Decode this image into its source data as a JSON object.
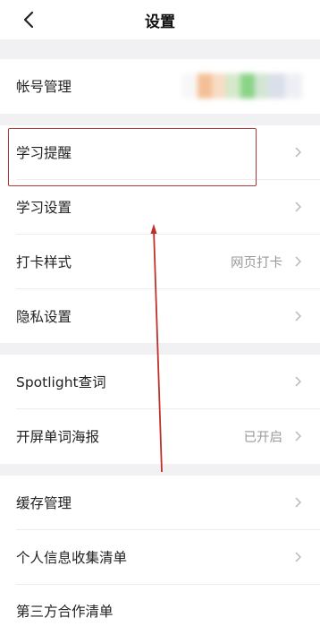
{
  "header": {
    "title": "设置",
    "back_icon": "chevron-left-icon"
  },
  "account": {
    "label": "帐号管理",
    "value_redacted": true
  },
  "study": {
    "reminder": "学习提醒",
    "settings": "学习设置",
    "checkin_style": "打卡样式",
    "checkin_style_value": "网页打卡",
    "privacy": "隐私设置"
  },
  "features": {
    "spotlight": "Spotlight查词",
    "splash_poster": "开屏单词海报",
    "splash_poster_value": "已开启"
  },
  "other": {
    "cache": "缓存管理",
    "personal_info": "个人信息收集清单",
    "third_party": "第三方合作清单"
  },
  "colors": {
    "highlight": "#b03a3a",
    "arrow": "#c0302a",
    "page_bg": "#f1f1f3"
  }
}
